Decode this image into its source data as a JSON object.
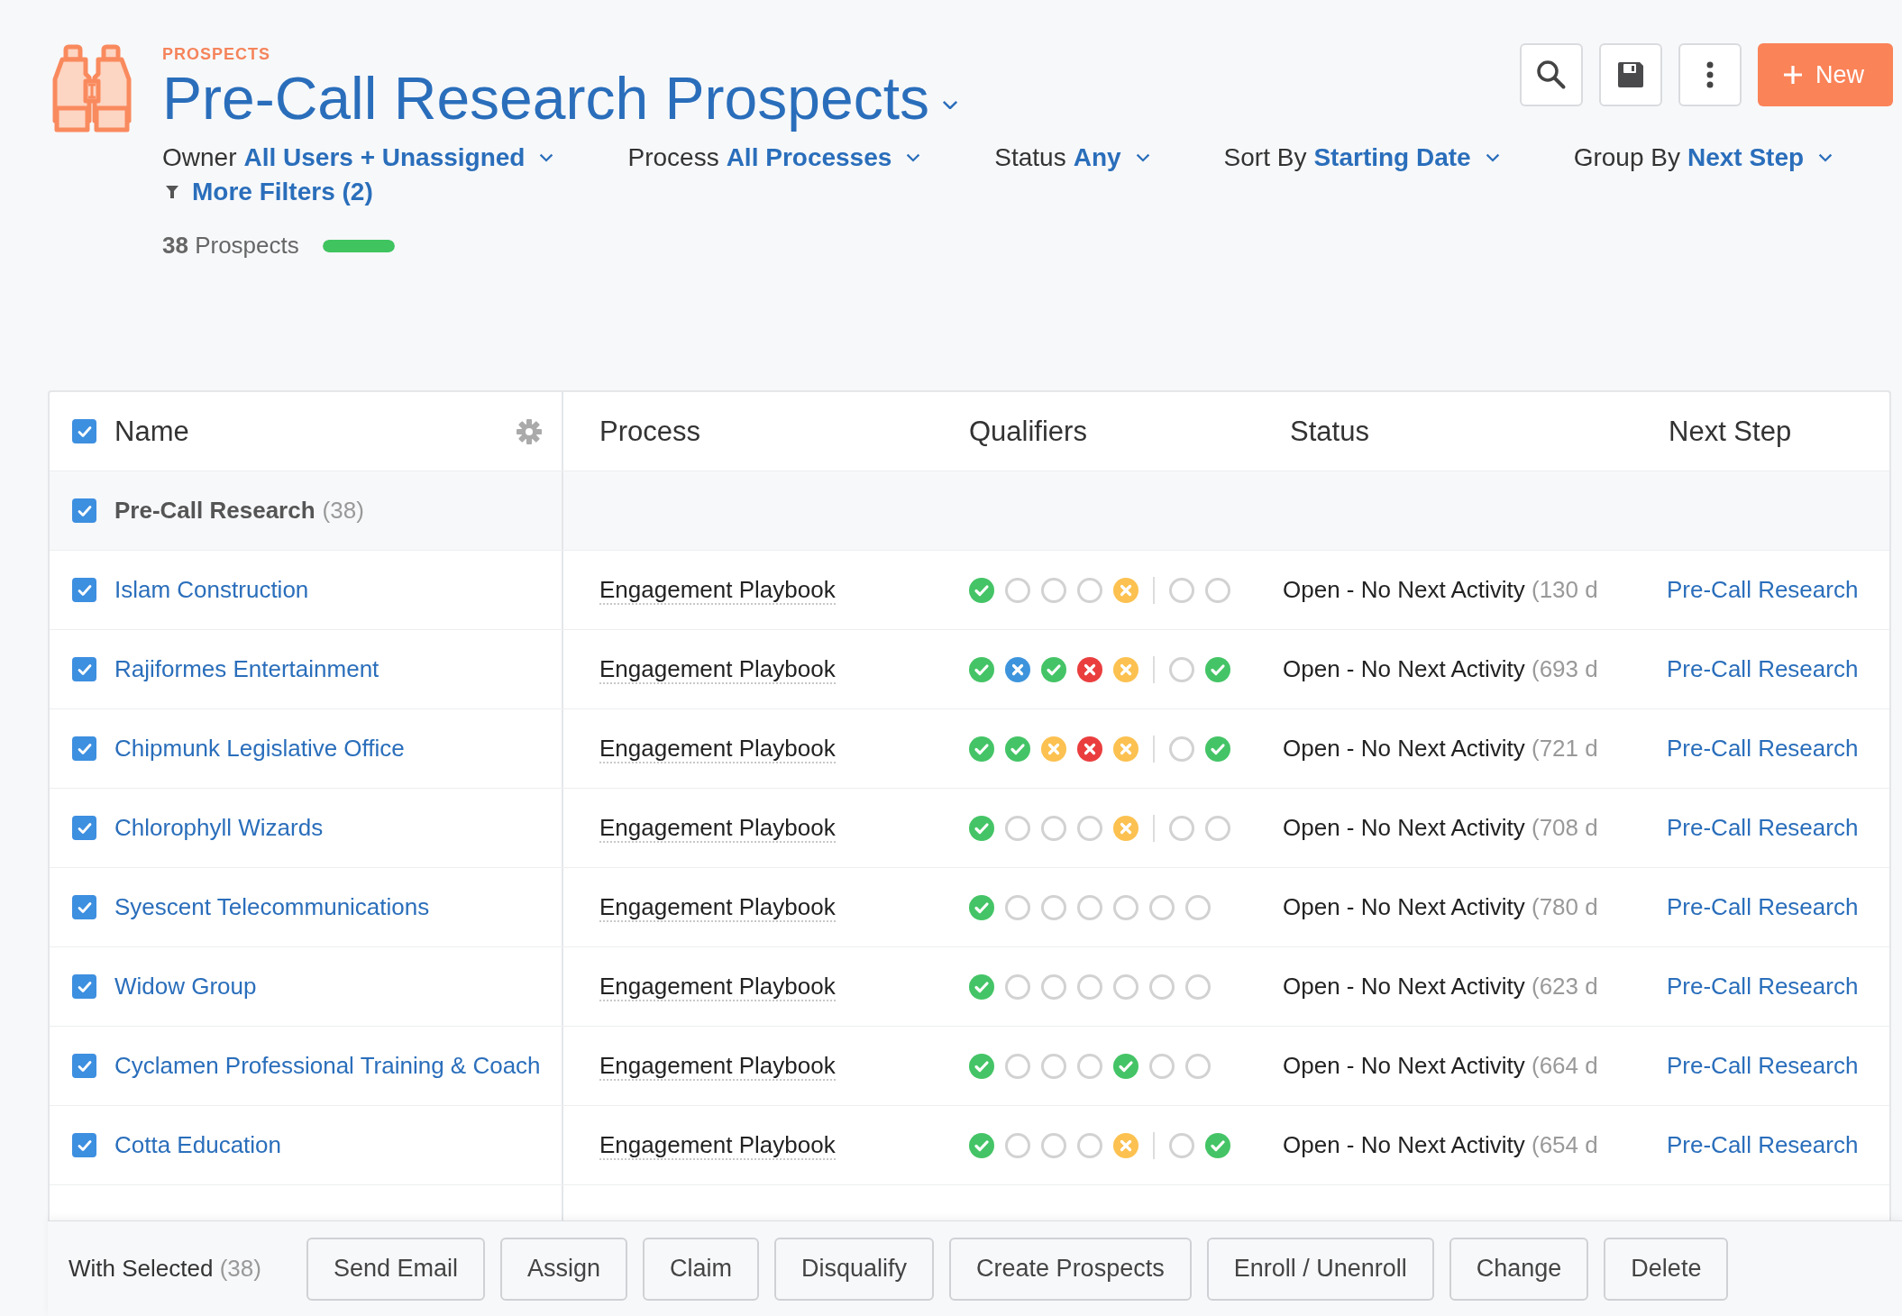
{
  "header": {
    "section_label": "PROSPECTS",
    "title": "Pre-Call Research Prospects",
    "new_button": "New",
    "filters": [
      {
        "label": "Owner",
        "value": "All Users + Unassigned"
      },
      {
        "label": "Process",
        "value": "All Processes"
      },
      {
        "label": "Status",
        "value": "Any"
      },
      {
        "label": "Sort By",
        "value": "Starting Date"
      },
      {
        "label": "Group By",
        "value": "Next Step"
      }
    ],
    "more_filters": "More Filters (2)",
    "count": "**38** Prospects",
    "progress": {
      "level": 1
    }
  },
  "table": {
    "columns": [
      "Name",
      "Process",
      "Qualifiers",
      "Status",
      "Next Step"
    ],
    "all_checked": true,
    "group": {
      "name": "Pre-Call Research",
      "count": "(38)",
      "checked": true
    },
    "rows": [
      {
        "checked": true,
        "name": "Islam Construction",
        "process": "Engagement Playbook",
        "divider": true,
        "qualifiers": [
          {
            "kind": "check",
            "color": "#44c466"
          },
          {
            "kind": "empty"
          },
          {
            "kind": "empty"
          },
          {
            "kind": "empty"
          },
          {
            "kind": "cross",
            "color": "#fcc150"
          },
          {
            "kind": "empty"
          },
          {
            "kind": "empty"
          }
        ],
        "status": "Open - No Next Activity",
        "age": "(130 d",
        "next_step": "Pre-Call Research"
      },
      {
        "checked": true,
        "name": "Rajiformes Entertainment",
        "process": "Engagement Playbook",
        "divider": true,
        "qualifiers": [
          {
            "kind": "check",
            "color": "#44c466"
          },
          {
            "kind": "cross",
            "color": "#3d94dc"
          },
          {
            "kind": "check",
            "color": "#44c466"
          },
          {
            "kind": "cross",
            "color": "#ea3e3e"
          },
          {
            "kind": "cross",
            "color": "#fcc150"
          },
          {
            "kind": "empty"
          },
          {
            "kind": "check",
            "color": "#44c466"
          }
        ],
        "status": "Open - No Next Activity",
        "age": "(693 d",
        "next_step": "Pre-Call Research"
      },
      {
        "checked": true,
        "name": "Chipmunk Legislative Office",
        "process": "Engagement Playbook",
        "divider": true,
        "qualifiers": [
          {
            "kind": "check",
            "color": "#44c466"
          },
          {
            "kind": "check",
            "color": "#44c466"
          },
          {
            "kind": "cross",
            "color": "#fcc150"
          },
          {
            "kind": "cross",
            "color": "#ea3e3e"
          },
          {
            "kind": "cross",
            "color": "#fcc150"
          },
          {
            "kind": "empty"
          },
          {
            "kind": "check",
            "color": "#44c466"
          }
        ],
        "status": "Open - No Next Activity",
        "age": "(721 d",
        "next_step": "Pre-Call Research"
      },
      {
        "checked": true,
        "name": "Chlorophyll Wizards",
        "process": "Engagement Playbook",
        "divider": true,
        "qualifiers": [
          {
            "kind": "check",
            "color": "#44c466"
          },
          {
            "kind": "empty"
          },
          {
            "kind": "empty"
          },
          {
            "kind": "empty"
          },
          {
            "kind": "cross",
            "color": "#fcc150"
          },
          {
            "kind": "empty"
          },
          {
            "kind": "empty"
          }
        ],
        "status": "Open - No Next Activity",
        "age": "(708 d",
        "next_step": "Pre-Call Research"
      },
      {
        "checked": true,
        "name": "Syescent Telecommunications",
        "process": "Engagement Playbook",
        "divider": false,
        "qualifiers": [
          {
            "kind": "check",
            "color": "#44c466"
          },
          {
            "kind": "empty"
          },
          {
            "kind": "empty"
          },
          {
            "kind": "empty"
          },
          {
            "kind": "empty"
          },
          {
            "kind": "empty"
          },
          {
            "kind": "empty"
          }
        ],
        "status": "Open - No Next Activity",
        "age": "(780 d",
        "next_step": "Pre-Call Research"
      },
      {
        "checked": true,
        "name": "Widow Group",
        "process": "Engagement Playbook",
        "divider": false,
        "qualifiers": [
          {
            "kind": "check",
            "color": "#44c466"
          },
          {
            "kind": "empty"
          },
          {
            "kind": "empty"
          },
          {
            "kind": "empty"
          },
          {
            "kind": "empty"
          },
          {
            "kind": "empty"
          },
          {
            "kind": "empty"
          }
        ],
        "status": "Open - No Next Activity",
        "age": "(623 d",
        "next_step": "Pre-Call Research"
      },
      {
        "checked": true,
        "name": "Cyclamen Professional Training & Coach",
        "process": "Engagement Playbook",
        "divider": false,
        "qualifiers": [
          {
            "kind": "check",
            "color": "#44c466"
          },
          {
            "kind": "empty"
          },
          {
            "kind": "empty"
          },
          {
            "kind": "empty"
          },
          {
            "kind": "check",
            "color": "#44c466"
          },
          {
            "kind": "empty"
          },
          {
            "kind": "empty"
          }
        ],
        "status": "Open - No Next Activity",
        "age": "(664 d",
        "next_step": "Pre-Call Research"
      },
      {
        "checked": true,
        "name": "Cotta Education",
        "process": "Engagement Playbook",
        "divider": true,
        "qualifiers": [
          {
            "kind": "check",
            "color": "#44c466"
          },
          {
            "kind": "empty"
          },
          {
            "kind": "empty"
          },
          {
            "kind": "empty"
          },
          {
            "kind": "cross",
            "color": "#fcc150"
          },
          {
            "kind": "empty"
          },
          {
            "kind": "check",
            "color": "#44c466"
          }
        ],
        "status": "Open - No Next Activity",
        "age": "(654 d",
        "next_step": "Pre-Call Research"
      }
    ]
  },
  "action_bar": {
    "label": "With Selected",
    "count": "(38)",
    "buttons": [
      "Send Email",
      "Assign",
      "Claim",
      "Disqualify",
      "Create Prospects",
      "Enroll / Unenroll",
      "Change",
      "Delete"
    ]
  }
}
